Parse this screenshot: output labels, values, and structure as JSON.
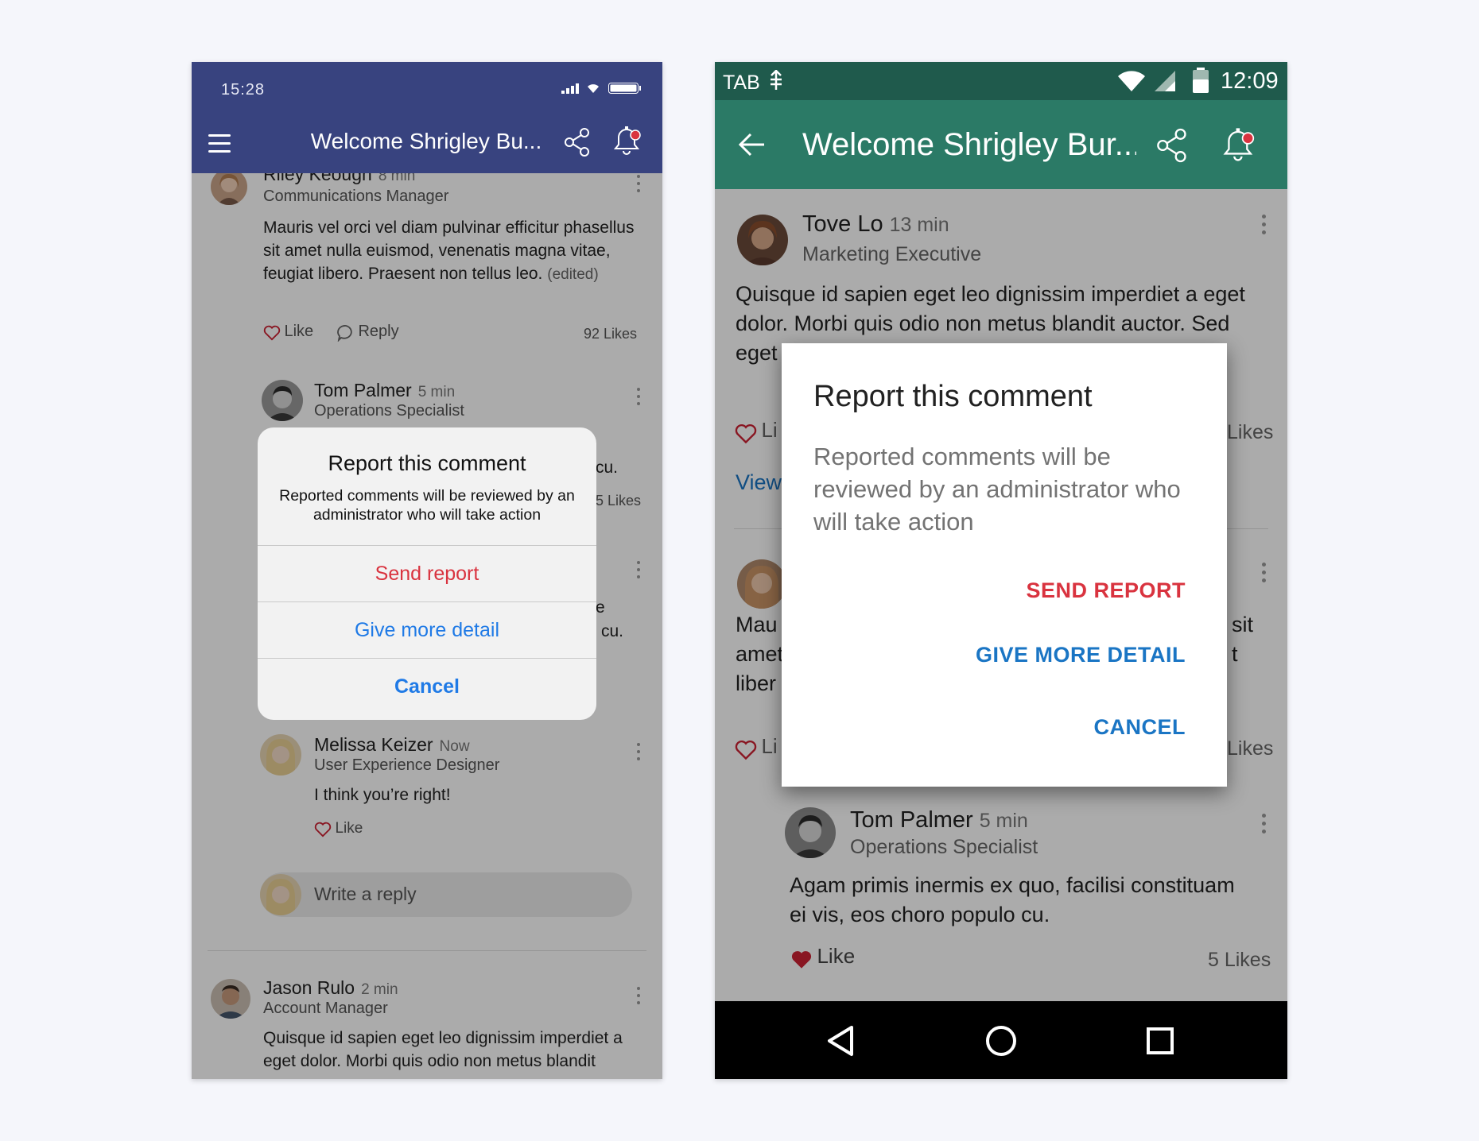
{
  "colors": {
    "ios_bar": "#38437f",
    "android_status": "#1f5a4c",
    "android_appbar": "#2b7a66",
    "destructive": "#d9333f",
    "ios_link": "#1f7ae6",
    "android_link": "#1a75c4",
    "like_heart": "#cc2233"
  },
  "ios": {
    "status_time": "15:28",
    "title": "Welcome Shrigley Bu...",
    "comments": [
      {
        "name": "Riley Keough",
        "time": "8 min",
        "role": "Communications Manager",
        "text": "Mauris vel orci vel diam pulvinar efficitur phasellus sit amet nulla euismod, venenatis magna vitae, feugiat libero. Praesent non tellus leo.",
        "edited": "(edited)",
        "like": "Like",
        "reply": "Reply",
        "likes": "92 Likes"
      },
      {
        "name": "Tom Palmer",
        "time": "5 min",
        "role": "Operations Specialist",
        "partial_1": "cu.",
        "partial_likes": "5 Likes",
        "partial_2": "e",
        "partial_3": "cu."
      },
      {
        "name": "Melissa Keizer",
        "time": "Now",
        "role": "User Experience Designer",
        "text": "I think you’re right!",
        "like": "Like"
      },
      {
        "name": "Jason Rulo",
        "time": "2 min",
        "role": "Account Manager",
        "text": "Quisque id sapien eget leo dignissim imperdiet a eget dolor. Morbi quis odio non metus blandit"
      }
    ],
    "reply_placeholder": "Write a reply",
    "alert": {
      "title": "Report this comment",
      "message": "Reported comments will be reviewed by an administrator who will take action",
      "send": "Send report",
      "detail": "Give more detail",
      "cancel": "Cancel"
    }
  },
  "android": {
    "status_left": "TAB",
    "status_time": "12:09",
    "title": "Welcome Shrigley Bur...",
    "post": {
      "name": "Tove Lo",
      "time": "13 min",
      "role": "Marketing Executive",
      "text_1": "Quisque id sapien eget leo dignissim imperdiet a eget",
      "text_2": "dolor. Morbi quis odio non metus blandit auctor. Sed",
      "text_3": "eget",
      "like_partial": "Li",
      "likes_partial": "Likes",
      "view_partial": "View"
    },
    "second": {
      "l1": "Mau",
      "l2": "amet",
      "l3": "liber",
      "r1": "sit",
      "r2": "t",
      "like_partial": "Li",
      "likes_partial": "Likes"
    },
    "reply": {
      "name": "Tom Palmer",
      "time": "5 min",
      "role": "Operations Specialist",
      "text_1": "Agam primis inermis ex quo, facilisi constituam",
      "text_2": "ei vis, eos choro populo cu.",
      "like": "Like",
      "likes": "5 Likes"
    },
    "dialog": {
      "title": "Report this comment",
      "message": "Reported comments will be reviewed by an administrator who will take action",
      "send": "SEND REPORT",
      "detail": "GIVE MORE DETAIL",
      "cancel": "CANCEL"
    }
  }
}
